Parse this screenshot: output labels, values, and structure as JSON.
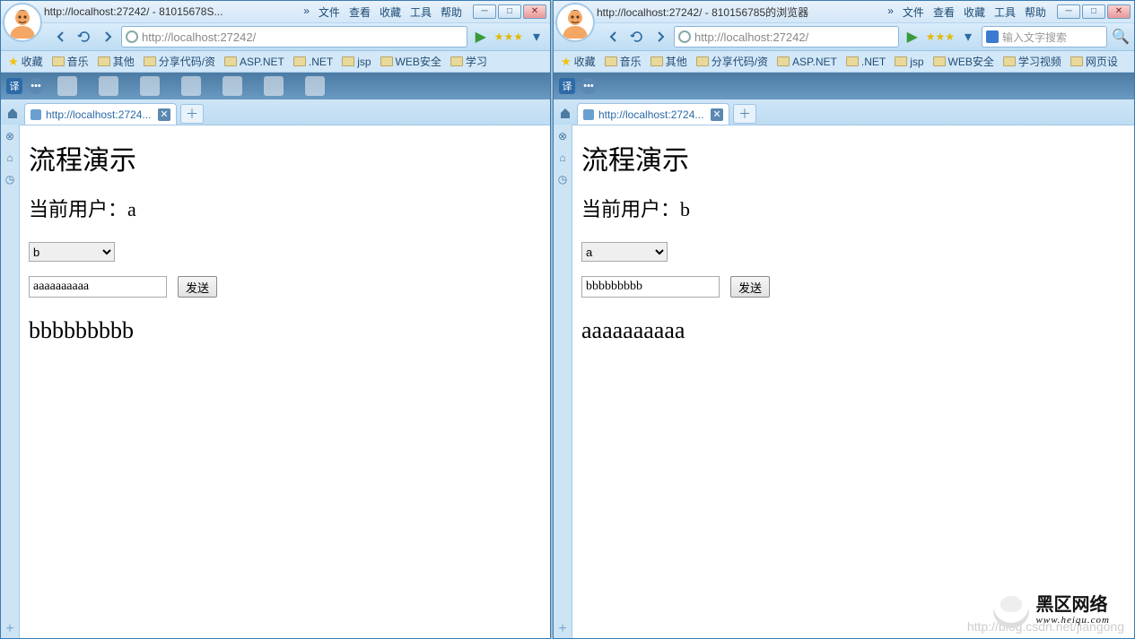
{
  "menus": {
    "more": "»",
    "file": "文件",
    "view": "查看",
    "fav": "收藏",
    "tools": "工具",
    "help": "帮助"
  },
  "winA": {
    "title": "http://localhost:27242/ - 81015678S...",
    "url": "http://localhost:27242/",
    "tab": "http://localhost:2724...",
    "page": {
      "heading": "流程演示",
      "user_label": "当前用户：",
      "user": "a",
      "select": "b",
      "input": "aaaaaaaaaa",
      "send": "发送",
      "received": "bbbbbbbbb"
    }
  },
  "winB": {
    "title": "http://localhost:27242/ - 810156785的浏览器",
    "url": "http://localhost:27242/",
    "tab": "http://localhost:2724...",
    "search_ph": "输入文字搜索",
    "page": {
      "heading": "流程演示",
      "user_label": "当前用户：",
      "user": "b",
      "select": "a",
      "input": "bbbbbbbbb",
      "send": "发送",
      "received": "aaaaaaaaaa"
    }
  },
  "bookmarks": {
    "fav": "收藏",
    "music": "音乐",
    "other": "其他",
    "share": "分享代码/资",
    "asp": "ASP.NET",
    "net": ".NET",
    "jsp": "jsp",
    "websec": "WEB安全",
    "study": "学习",
    "studyvid": "学习视频",
    "webpage": "网页设"
  },
  "watermark": "http://blog.csdn.net/jiangong",
  "brand": {
    "cn": "黑区网络",
    "en": "www.heiqu.com"
  }
}
